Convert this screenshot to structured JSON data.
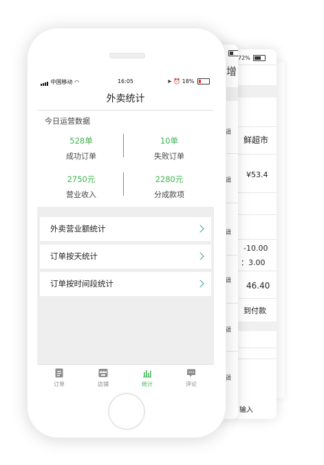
{
  "status_bar": {
    "carrier": "中国移动",
    "time": "16:05",
    "battery": "18%"
  },
  "nav": {
    "title": "外卖统计"
  },
  "stats": {
    "section_title": "今日运营数据",
    "items": [
      {
        "value": "528单",
        "label": "成功订单"
      },
      {
        "value": "10单",
        "label": "失败订单"
      },
      {
        "value": "2750元",
        "label": "营业收入"
      },
      {
        "value": "2280元",
        "label": "分成款项"
      }
    ]
  },
  "menu": [
    {
      "label": "外卖营业额统计"
    },
    {
      "label": "订单按天统计"
    },
    {
      "label": "订单按时间段统计"
    }
  ],
  "tabs": [
    {
      "label": "订单",
      "icon": "document-icon",
      "active": false
    },
    {
      "label": "店铺",
      "icon": "store-icon",
      "active": false
    },
    {
      "label": "统计",
      "icon": "bar-chart-icon",
      "active": true
    },
    {
      "label": "评论",
      "icon": "comment-icon",
      "active": false
    }
  ],
  "background_screens": {
    "back1": {
      "status": "%",
      "header": "新增",
      "edit_label": "编辑"
    },
    "back2": {
      "status": "72%",
      "shop": "鲜超市",
      "price": "¥53.4",
      "discount": "-10.00",
      "fee": "：3.00",
      "total": "46.40",
      "payment": "到付款",
      "footer": "输入"
    }
  },
  "colors": {
    "accent_green": "#3db34f",
    "chevron_teal": "#3a9aa0"
  }
}
